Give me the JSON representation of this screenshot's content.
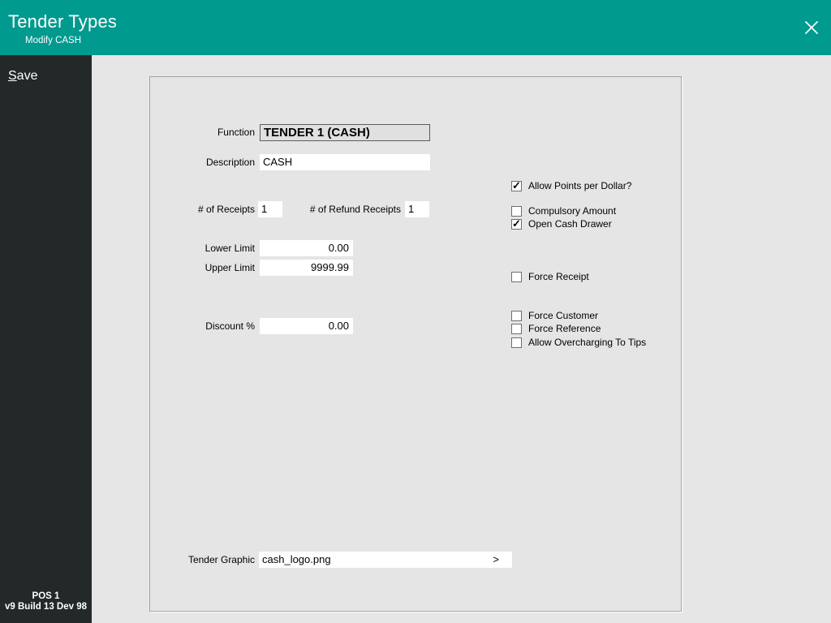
{
  "header": {
    "title": "Tender Types",
    "subtitle": "Modify CASH"
  },
  "sidebar": {
    "save_accesskey": "S",
    "save_label_rest": "ave",
    "footer_line1": "POS 1",
    "footer_line2": "v9 Build 13 Dev 98"
  },
  "form": {
    "function": {
      "label": "Function",
      "value": "TENDER 1 (CASH)"
    },
    "description": {
      "label": "Description",
      "value": "CASH"
    },
    "receipts": {
      "label": "# of Receipts",
      "value": "1"
    },
    "refund_receipts": {
      "label": "# of Refund Receipts",
      "value": "1"
    },
    "lower_limit": {
      "label": "Lower Limit",
      "value": "0.00"
    },
    "upper_limit": {
      "label": "Upper Limit",
      "value": "9999.99"
    },
    "discount": {
      "label": "Discount %",
      "value": "0.00"
    },
    "tender_graphic": {
      "label": "Tender Graphic",
      "value": "cash_logo.png",
      "browse_label": ">"
    },
    "checkboxes": [
      {
        "label": "Allow Points per Dollar?",
        "checked": true
      },
      {
        "label": "Compulsory Amount",
        "checked": false
      },
      {
        "label": "Open Cash Drawer",
        "checked": true
      },
      {
        "label": "Force Receipt",
        "checked": false
      },
      {
        "label": "Force Customer",
        "checked": false
      },
      {
        "label": "Force Reference",
        "checked": false
      },
      {
        "label": "Allow Overcharging To Tips",
        "checked": false
      }
    ]
  },
  "colors": {
    "accent_teal": "#009A8E",
    "sidebar_dark": "#232829",
    "background": "#e6e6e6"
  }
}
